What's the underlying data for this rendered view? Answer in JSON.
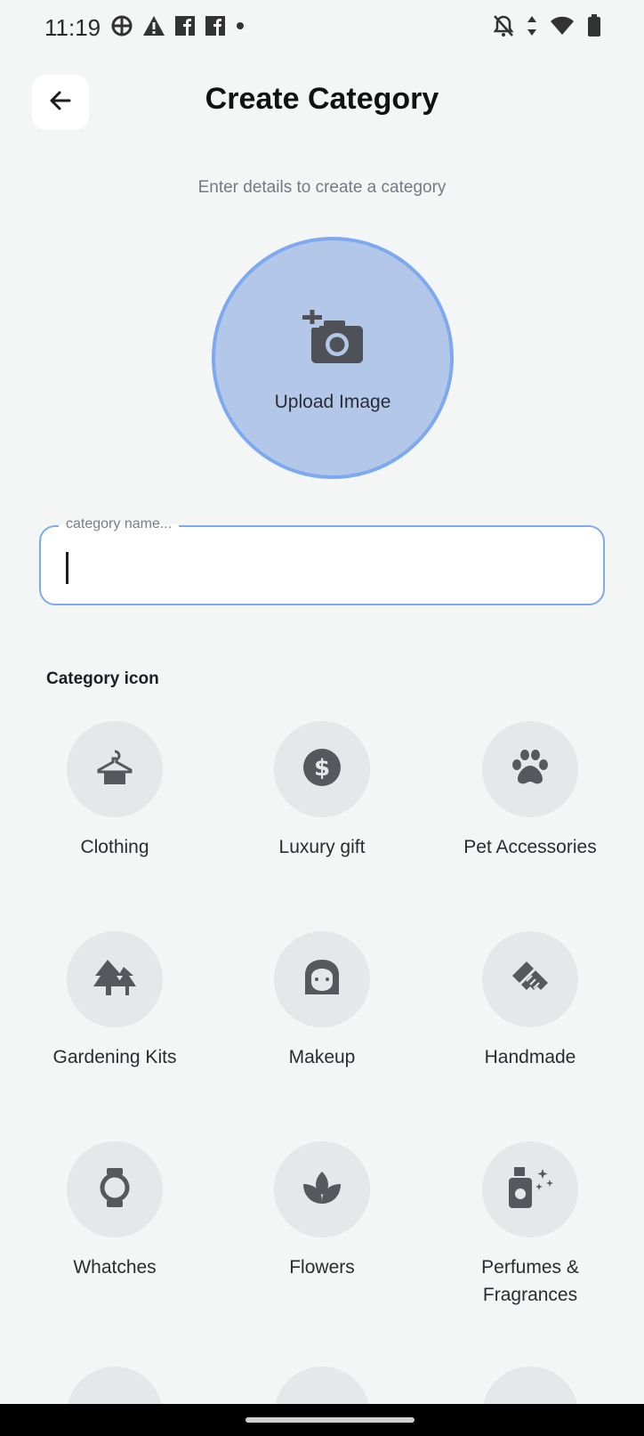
{
  "status_bar": {
    "time": "11:19",
    "icons": [
      "vpn-icon",
      "warning-icon",
      "facebook-icon",
      "facebook-icon",
      "dot-icon",
      "bell-off-icon",
      "data-icon",
      "wifi-icon",
      "battery-icon"
    ]
  },
  "header": {
    "back_icon": "arrow-left-icon",
    "title": "Create Category"
  },
  "subtitle": "Enter details to create a category",
  "upload": {
    "icon": "add-camera-icon",
    "label": "Upload Image",
    "colors": {
      "fill": "#b3c7e8",
      "border": "#7da9f0"
    }
  },
  "name_field": {
    "label": "category name...",
    "value": ""
  },
  "category_icon_section": {
    "label": "Category icon",
    "items": [
      {
        "label": "Clothing",
        "icon": "hanger-icon"
      },
      {
        "label": "Luxury gift",
        "icon": "dollar-coin-icon"
      },
      {
        "label": "Pet Accessories",
        "icon": "paw-icon"
      },
      {
        "label": "Gardening Kits",
        "icon": "trees-icon"
      },
      {
        "label": "Makeup",
        "icon": "face-icon"
      },
      {
        "label": "Handmade",
        "icon": "handshake-icon"
      },
      {
        "label": "Whatches",
        "icon": "watch-icon"
      },
      {
        "label": "Flowers",
        "icon": "lotus-icon"
      },
      {
        "label": "Perfumes &\nFragrances",
        "icon": "perfume-icon"
      }
    ]
  }
}
